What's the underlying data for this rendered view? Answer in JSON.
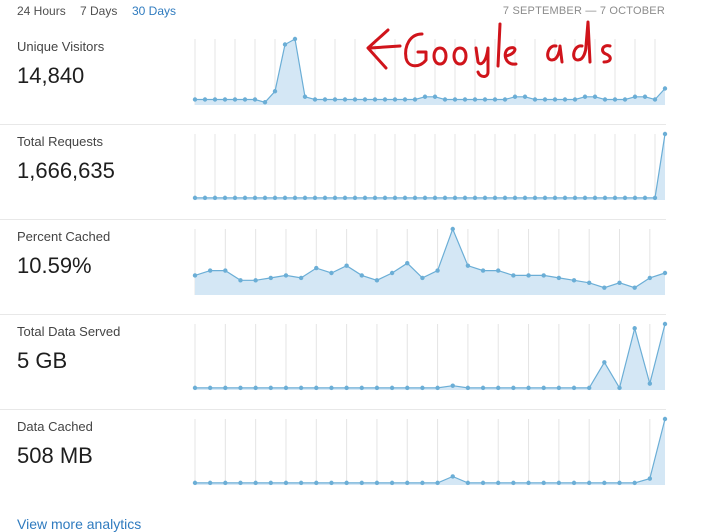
{
  "range_tabs": [
    {
      "label": "24 Hours",
      "active": false
    },
    {
      "label": "7 Days",
      "active": false
    },
    {
      "label": "30 Days",
      "active": true
    }
  ],
  "date_range": "7 SEPTEMBER — 7 OCTOBER",
  "annotation": "Google ads",
  "accent_color": "#2f7bbf",
  "metrics": [
    {
      "label": "Unique Visitors",
      "value": "14,840",
      "series": [
        2,
        2,
        2,
        2,
        2,
        2,
        2,
        1,
        5,
        22,
        24,
        3,
        2,
        2,
        2,
        2,
        2,
        2,
        2,
        2,
        2,
        2,
        2,
        3,
        3,
        2,
        2,
        2,
        2,
        2,
        2,
        2,
        3,
        3,
        2,
        2,
        2,
        2,
        2,
        3,
        3,
        2,
        2,
        2,
        3,
        3,
        2,
        6
      ],
      "max": 24
    },
    {
      "label": "Total Requests",
      "value": "1,666,635",
      "series": [
        1,
        1,
        1,
        1,
        1,
        1,
        1,
        1,
        1,
        1,
        1,
        1,
        1,
        1,
        1,
        1,
        1,
        1,
        1,
        1,
        1,
        1,
        1,
        1,
        1,
        1,
        1,
        1,
        1,
        1,
        1,
        1,
        1,
        1,
        1,
        1,
        1,
        1,
        1,
        1,
        1,
        1,
        1,
        1,
        1,
        1,
        1,
        31
      ],
      "max": 31
    },
    {
      "label": "Percent Cached",
      "value": "10.59%",
      "series": [
        8,
        10,
        10,
        6,
        6,
        7,
        8,
        7,
        11,
        9,
        12,
        8,
        6,
        9,
        13,
        7,
        10,
        27,
        12,
        10,
        10,
        8,
        8,
        8,
        7,
        6,
        5,
        3,
        5,
        3,
        7,
        9
      ],
      "max": 27
    },
    {
      "label": "Total Data Served",
      "value": "5 GB",
      "series": [
        1,
        1,
        1,
        1,
        1,
        1,
        1,
        1,
        1,
        1,
        1,
        1,
        1,
        1,
        1,
        1,
        1,
        2,
        1,
        1,
        1,
        1,
        1,
        1,
        1,
        1,
        1,
        13,
        1,
        29,
        3,
        31
      ],
      "max": 31
    },
    {
      "label": "Data Cached",
      "value": "508 MB",
      "series": [
        1,
        1,
        1,
        1,
        1,
        1,
        1,
        1,
        1,
        1,
        1,
        1,
        1,
        1,
        1,
        1,
        1,
        4,
        1,
        1,
        1,
        1,
        1,
        1,
        1,
        1,
        1,
        1,
        1,
        1,
        3,
        31
      ],
      "max": 31
    }
  ],
  "view_more_label": "View more analytics"
}
